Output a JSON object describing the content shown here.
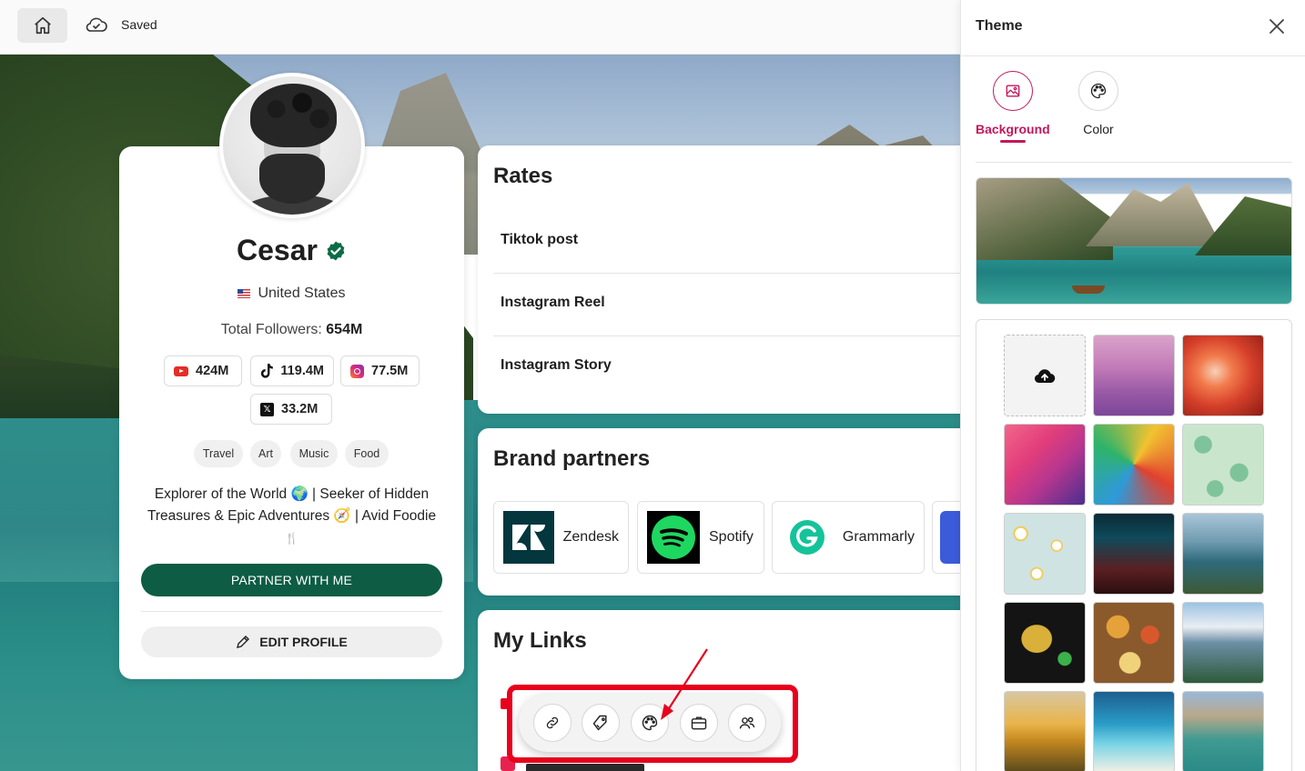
{
  "topbar": {
    "saved_label": "Saved"
  },
  "profile": {
    "name": "Cesar",
    "location": "United States",
    "followers_label": "Total Followers: ",
    "followers_value": "654M",
    "stats": {
      "youtube": "424M",
      "tiktok": "119.4M",
      "instagram": "77.5M",
      "x": "33.2M"
    },
    "tags": [
      "Travel",
      "Art",
      "Music",
      "Food"
    ],
    "bio_line1": "Explorer of the World 🌍 | Seeker of Hidden",
    "bio_line2": "Treasures & Epic Adventures 🧭 | Avid Foodie",
    "bio_line3": "🍴",
    "partner_button": "PARTNER WITH ME",
    "edit_button": "EDIT PROFILE"
  },
  "rates": {
    "title": "Rates",
    "items": [
      "Tiktok post",
      "Instagram Reel",
      "Instagram Story"
    ]
  },
  "brands": {
    "title": "Brand partners",
    "items": [
      "Zendesk",
      "Spotify",
      "Grammarly"
    ]
  },
  "links": {
    "title": "My Links"
  },
  "toolbar": {
    "tools": [
      "link-icon",
      "tag-icon",
      "palette-icon",
      "briefcase-icon",
      "users-icon"
    ]
  },
  "theme": {
    "title": "Theme",
    "tab_background": "Background",
    "tab_color": "Color",
    "accent_color": "#c2185b"
  },
  "colors": {
    "partner_button": "#0d5c43",
    "highlight": "#e8001c"
  }
}
